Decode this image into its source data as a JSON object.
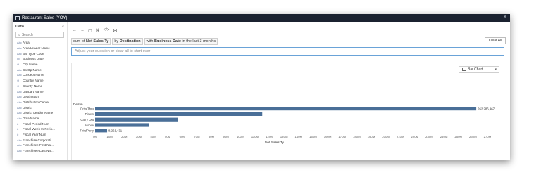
{
  "window": {
    "title": "Restaurant Sales (YOY)",
    "close_glyph": "×"
  },
  "sidebar": {
    "header": "Data",
    "search_placeholder": "Search",
    "fields": [
      {
        "icon": "Abc",
        "name": "Area"
      },
      {
        "icon": "Abc",
        "name": "Area Leader Name"
      },
      {
        "icon": "Abc",
        "name": "Bar Type Code"
      },
      {
        "icon": "▤",
        "name": "Business Date"
      },
      {
        "icon": "⊕",
        "name": "City Name"
      },
      {
        "icon": "Abc",
        "name": "Co Op Name"
      },
      {
        "icon": "Abc",
        "name": "Concept Name"
      },
      {
        "icon": "⊕",
        "name": "Country Name"
      },
      {
        "icon": "⊕",
        "name": "County Name"
      },
      {
        "icon": "Abc",
        "name": "Daypart Name"
      },
      {
        "icon": "Abc",
        "name": "Destination"
      },
      {
        "icon": "Abc",
        "name": "Distribution Center"
      },
      {
        "icon": "Abc",
        "name": "District"
      },
      {
        "icon": "Abc",
        "name": "District Leader Name"
      },
      {
        "icon": "Abc",
        "name": "Dma Name"
      },
      {
        "icon": "#",
        "name": "Fiscal Period Num"
      },
      {
        "icon": "#",
        "name": "Fiscal Week In Perio..."
      },
      {
        "icon": "#",
        "name": "Fiscal Year Num"
      },
      {
        "icon": "Abc",
        "name": "Franchise Corporati..."
      },
      {
        "icon": "Abc",
        "name": "Franchisee First Na..."
      },
      {
        "icon": "Abc",
        "name": "Franchisee Last Na..."
      }
    ]
  },
  "toolbar": {
    "back": "←",
    "forward": "→",
    "present": "▢",
    "share": "⌘",
    "embed": "</>",
    "link": "⋈"
  },
  "query": {
    "p1": "sum of",
    "b1": "Net Sales Ty",
    "p2": "by",
    "b2": "Destination",
    "p3": "with",
    "b3": "Business Date",
    "p4": "in the last 3 months"
  },
  "clear_all": "Clear All",
  "ask_placeholder": "Adjust your question or clear all to start over",
  "chart_type_label": "Bar Chart",
  "chart_data": {
    "type": "bar",
    "orientation": "horizontal",
    "ylabel": "Destin...",
    "xlabel": "Net Sales Ty",
    "categories": [
      "DriveThru",
      "DineIn",
      "Carry Out",
      "Mobile",
      "ThirdParty"
    ],
    "values": [
      262286467,
      115000000,
      57000000,
      37000000,
      8261431
    ],
    "data_labels": [
      "262,286,467",
      "",
      "",
      "",
      "8,261,431"
    ],
    "xlim": [
      0,
      270000000
    ],
    "tick_labels": [
      "0M",
      "10M",
      "20M",
      "30M",
      "40M",
      "50M",
      "60M",
      "70M",
      "80M",
      "90M",
      "100M",
      "110M",
      "120M",
      "130M",
      "140M",
      "150M",
      "160M",
      "170M",
      "180M",
      "190M",
      "200M",
      "210M",
      "220M",
      "230M",
      "240M",
      "250M",
      "260M",
      "270M"
    ],
    "bar_color": "#4a6f98",
    "grid": false
  }
}
